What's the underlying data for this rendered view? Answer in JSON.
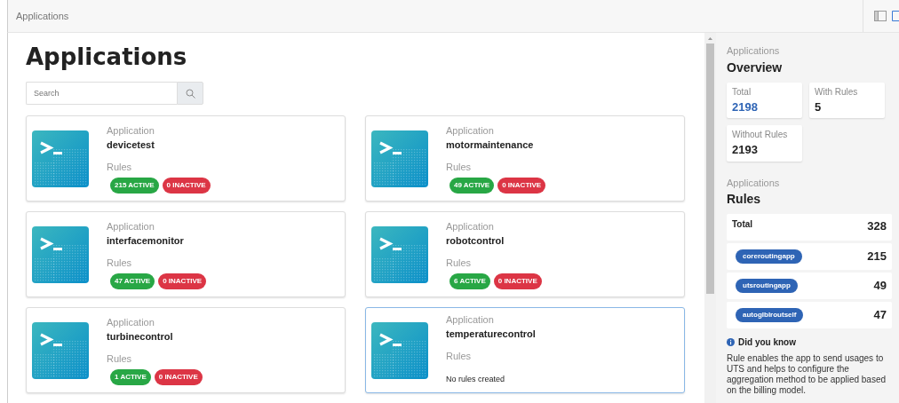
{
  "header": {
    "title": "Applications"
  },
  "main": {
    "heading": "Applications",
    "search": {
      "placeholder": "Search"
    },
    "apps": [
      {
        "label": "Application",
        "name": "devicetest",
        "rules_label": "Rules",
        "active": "215 ACTIVE",
        "inactive": "0 INACTIVE",
        "selected": false
      },
      {
        "label": "Application",
        "name": "motormaintenance",
        "rules_label": "Rules",
        "active": "49 ACTIVE",
        "inactive": "0 INACTIVE",
        "selected": false
      },
      {
        "label": "Application",
        "name": "interfacemonitor",
        "rules_label": "Rules",
        "active": "47 ACTIVE",
        "inactive": "0 INACTIVE",
        "selected": false
      },
      {
        "label": "Application",
        "name": "robotcontrol",
        "rules_label": "Rules",
        "active": "6 ACTIVE",
        "inactive": "0 INACTIVE",
        "selected": false
      },
      {
        "label": "Application",
        "name": "turbinecontrol",
        "rules_label": "Rules",
        "active": "1 ACTIVE",
        "inactive": "0 INACTIVE",
        "selected": false
      },
      {
        "label": "Application",
        "name": "temperaturecontrol",
        "rules_label": "Rules",
        "note": "No rules created",
        "selected": true
      }
    ]
  },
  "sidebar": {
    "overview": {
      "caption": "Applications",
      "title": "Overview",
      "stats": [
        {
          "label": "Total",
          "value": "2198",
          "highlight": true
        },
        {
          "label": "With Rules",
          "value": "5",
          "highlight": false
        },
        {
          "label": "Without Rules",
          "value": "2193",
          "highlight": false
        }
      ]
    },
    "rules": {
      "caption": "Applications",
      "title": "Rules",
      "total_label": "Total",
      "total": "328",
      "items": [
        {
          "name": "coreroutingapp",
          "count": "215"
        },
        {
          "name": "utsroutingapp",
          "count": "49"
        },
        {
          "name": "autoglblroutself",
          "count": "47"
        }
      ]
    },
    "tip": {
      "title": "Did you know",
      "text": "Rule enables the app to send usages to UTS and helps to configure the aggregation method to be applied based on the billing model."
    }
  }
}
